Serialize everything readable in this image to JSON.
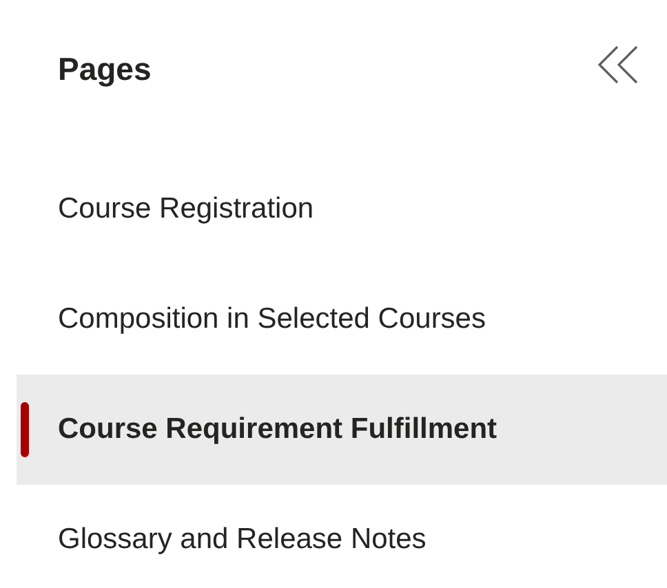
{
  "panel": {
    "title": "Pages"
  },
  "items": [
    {
      "label": "Course Registration",
      "selected": false
    },
    {
      "label": "Composition in Selected Courses",
      "selected": false
    },
    {
      "label": "Course Requirement Fulfillment",
      "selected": true
    },
    {
      "label": "Glossary and Release Notes",
      "selected": false
    }
  ]
}
